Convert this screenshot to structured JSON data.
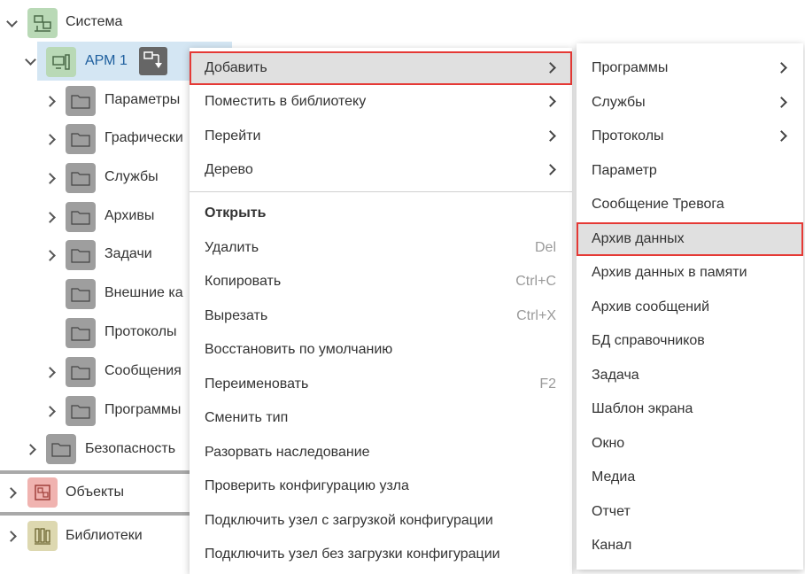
{
  "tree": {
    "system": "Система",
    "arm": "АРМ 1",
    "children": [
      "Параметры",
      "Графически",
      "Службы",
      "Архивы",
      "Задачи",
      "Внешние ка",
      "Протоколы",
      "Сообщения",
      "Программы"
    ],
    "security": "Безопасность",
    "objects": "Объекты",
    "libraries": "Библиотеки"
  },
  "context_menu": {
    "add": "Добавить",
    "place_library": "Поместить в библиотеку",
    "goto": "Перейти",
    "tree": "Дерево",
    "open": "Открыть",
    "delete": "Удалить",
    "delete_key": "Del",
    "copy": "Копировать",
    "copy_key": "Ctrl+C",
    "cut": "Вырезать",
    "cut_key": "Ctrl+X",
    "restore": "Восстановить по умолчанию",
    "rename": "Переименовать",
    "rename_key": "F2",
    "change_type": "Сменить тип",
    "break_inherit": "Разорвать наследование",
    "check_config": "Проверить конфигурацию узла",
    "connect_with": "Подключить узел с загрузкой конфигурации",
    "connect_without": "Подключить узел без загрузки конфигурации"
  },
  "submenu": {
    "programs": "Программы",
    "services": "Службы",
    "protocols": "Протоколы",
    "parameter": "Параметр",
    "alarm": "Сообщение Тревога",
    "data_archive": "Архив данных",
    "mem_archive": "Архив данных в памяти",
    "msg_archive": "Архив сообщений",
    "ref_db": "БД справочников",
    "task": "Задача",
    "screen_tpl": "Шаблон экрана",
    "window": "Окно",
    "media": "Медиа",
    "report": "Отчет",
    "channel": "Канал"
  },
  "colors": {
    "highlight_border": "#e53935",
    "selected_row": "#d4e6f3"
  }
}
